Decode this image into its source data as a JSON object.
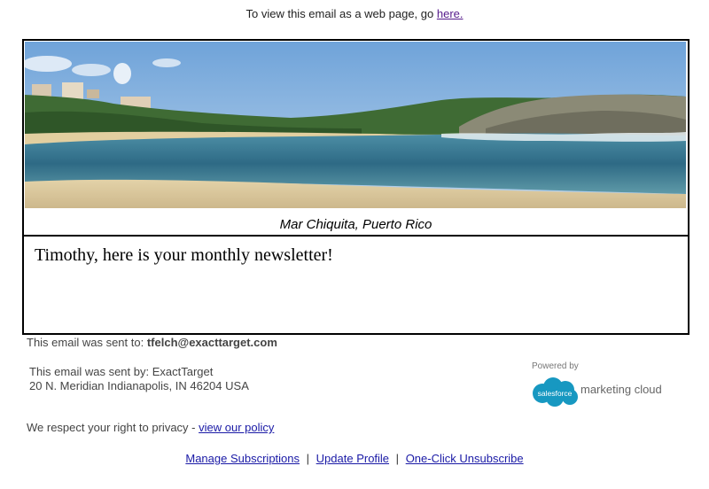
{
  "header": {
    "prefix": "To view this email as a web page, go",
    "link_text": "here."
  },
  "hero": {
    "caption": "Mar Chiquita, Puerto Rico",
    "colors": {
      "sky": "#8fb8e0",
      "sea": "#2f6f8e",
      "sand": "#d8c59a",
      "hills": "#3f6b34"
    }
  },
  "body": {
    "greeting": "Timothy, here is your monthly newsletter!"
  },
  "footer": {
    "sent_to_prefix": "This email was sent to:",
    "sent_to_email": "tfelch@exacttarget.com",
    "sent_by_line": "This email was sent by: ExactTarget",
    "address_line": "20 N. Meridian Indianapolis, IN 46204 USA",
    "powered_by": "Powered by",
    "brand_word": "salesforce",
    "brand_product": "marketing cloud",
    "privacy_prefix": "We respect your right to privacy -",
    "privacy_link": "view our policy",
    "links": {
      "manage": "Manage Subscriptions",
      "update": "Update Profile",
      "unsubscribe": "One-Click Unsubscribe",
      "separator": "|"
    }
  }
}
